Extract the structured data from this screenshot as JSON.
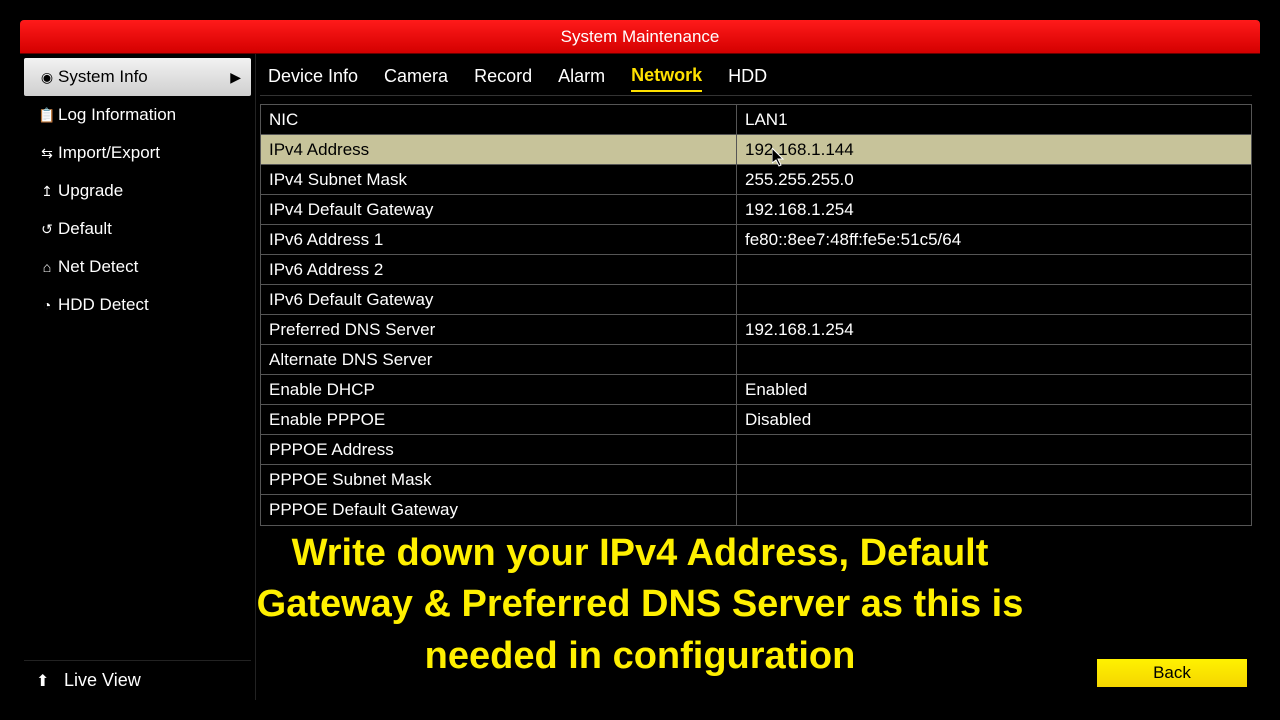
{
  "title": "System Maintenance",
  "sidebar": {
    "items": [
      {
        "label": "System Info",
        "icon": "◉",
        "active": true,
        "name": "sidebar-item-system-info"
      },
      {
        "label": "Log Information",
        "icon": "📋",
        "name": "sidebar-item-log-info"
      },
      {
        "label": "Import/Export",
        "icon": "⇆",
        "name": "sidebar-item-import-export"
      },
      {
        "label": "Upgrade",
        "icon": "↥",
        "name": "sidebar-item-upgrade"
      },
      {
        "label": "Default",
        "icon": "↺",
        "name": "sidebar-item-default"
      },
      {
        "label": "Net Detect",
        "icon": "⌂",
        "name": "sidebar-item-net-detect"
      },
      {
        "label": "HDD Detect",
        "icon": "◔",
        "name": "sidebar-item-hdd-detect"
      }
    ],
    "footer": {
      "label": "Live View",
      "icon": "⬆"
    }
  },
  "tabs": [
    {
      "label": "Device Info",
      "name": "tab-device-info"
    },
    {
      "label": "Camera",
      "name": "tab-camera"
    },
    {
      "label": "Record",
      "name": "tab-record"
    },
    {
      "label": "Alarm",
      "name": "tab-alarm"
    },
    {
      "label": "Network",
      "name": "tab-network",
      "active": true
    },
    {
      "label": "HDD",
      "name": "tab-hdd"
    }
  ],
  "table": {
    "header": {
      "label": "NIC",
      "value": "LAN1"
    },
    "rows": [
      {
        "label": "IPv4 Address",
        "value": "192.168.1.144",
        "highlight": true
      },
      {
        "label": "IPv4 Subnet Mask",
        "value": "255.255.255.0"
      },
      {
        "label": "IPv4 Default Gateway",
        "value": "192.168.1.254"
      },
      {
        "label": "IPv6 Address 1",
        "value": "fe80::8ee7:48ff:fe5e:51c5/64"
      },
      {
        "label": "IPv6 Address 2",
        "value": ""
      },
      {
        "label": "IPv6 Default Gateway",
        "value": ""
      },
      {
        "label": "Preferred DNS Server",
        "value": "192.168.1.254"
      },
      {
        "label": "Alternate DNS Server",
        "value": ""
      },
      {
        "label": "Enable DHCP",
        "value": "Enabled"
      },
      {
        "label": "Enable PPPOE",
        "value": "Disabled"
      },
      {
        "label": "PPPOE Address",
        "value": ""
      },
      {
        "label": "PPPOE Subnet Mask",
        "value": ""
      },
      {
        "label": "PPPOE Default Gateway",
        "value": ""
      }
    ]
  },
  "back_label": "Back",
  "overlay": "Write down your IPv4 Address, Default Gateway & Preferred DNS Server as this is needed in configuration"
}
